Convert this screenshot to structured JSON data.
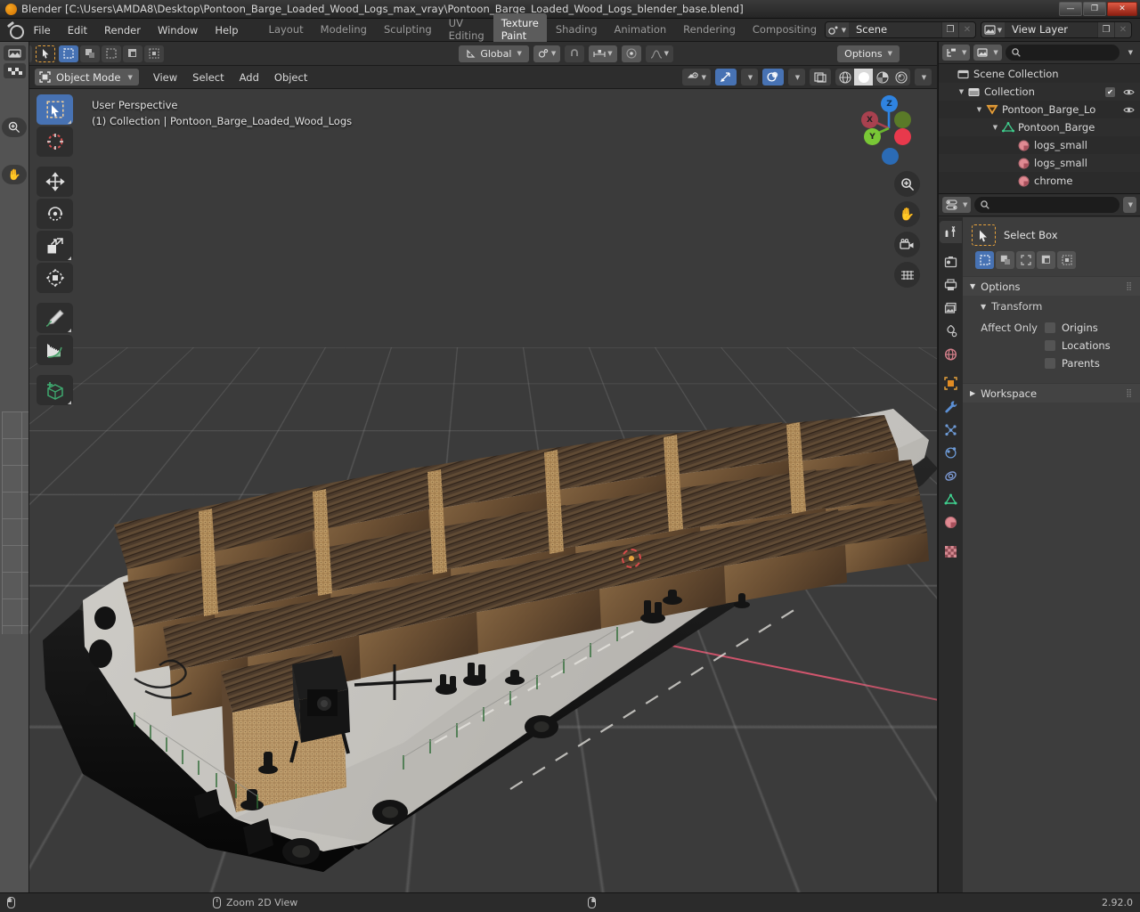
{
  "window": {
    "title": "Blender [C:\\Users\\AMDA8\\Desktop\\Pontoon_Barge_Loaded_Wood_Logs_max_vray\\Pontoon_Barge_Loaded_Wood_Logs_blender_base.blend]",
    "minimize": "—",
    "maximize": "❐",
    "close": "✕"
  },
  "topbar": {
    "menus": [
      "File",
      "Edit",
      "Render",
      "Window",
      "Help"
    ],
    "workspaces": [
      {
        "label": "Layout",
        "active": false
      },
      {
        "label": "Modeling",
        "active": false
      },
      {
        "label": "Sculpting",
        "active": false
      },
      {
        "label": "UV Editing",
        "active": false
      },
      {
        "label": "Texture Paint",
        "active": true
      },
      {
        "label": "Shading",
        "active": false
      },
      {
        "label": "Animation",
        "active": false
      },
      {
        "label": "Rendering",
        "active": false
      },
      {
        "label": "Compositing",
        "active": false
      }
    ],
    "scene": {
      "name": "Scene",
      "new_label": "❐",
      "unlink_label": "✕"
    },
    "view_layer": {
      "name": "View Layer",
      "new_label": "❐",
      "unlink_label": "✕"
    }
  },
  "tool_settings": {
    "transform_orientation": "Global",
    "options_label": "Options",
    "snap_icon": "magnet-icon",
    "proportional_icon": "proportional-edit-icon"
  },
  "viewport_header": {
    "mode": "Object Mode",
    "menus": [
      "View",
      "Select",
      "Add",
      "Object"
    ],
    "shading_modes": [
      "wireframe",
      "solid",
      "material-preview",
      "rendered"
    ],
    "active_shading": "solid"
  },
  "viewport": {
    "perspective_label": "User Perspective",
    "scene_info": "(1) Collection | Pontoon_Barge_Loaded_Wood_Logs",
    "gizmo_axes": [
      "X",
      "Y",
      "Z"
    ],
    "nav_buttons": [
      "zoom-icon",
      "pan-icon",
      "camera-icon",
      "grid-icon"
    ],
    "toolbar": [
      {
        "name": "select-box",
        "label": "Select Box",
        "active": true
      },
      {
        "name": "cursor",
        "label": "Cursor",
        "active": false
      },
      {
        "name": "move",
        "label": "Move",
        "active": false
      },
      {
        "name": "rotate",
        "label": "Rotate",
        "active": false
      },
      {
        "name": "scale",
        "label": "Scale",
        "active": false
      },
      {
        "name": "transform",
        "label": "Transform",
        "active": false
      },
      {
        "name": "annotate",
        "label": "Annotate",
        "active": false
      },
      {
        "name": "measure",
        "label": "Measure",
        "active": false
      },
      {
        "name": "add-cube",
        "label": "Add Cube",
        "active": false
      }
    ]
  },
  "outliner": {
    "search_placeholder": "",
    "rows": [
      {
        "label": "Scene Collection",
        "depth": 0,
        "icon": "collection-icon",
        "expand": "",
        "checkbox": false,
        "eye": false
      },
      {
        "label": "Collection",
        "depth": 1,
        "icon": "collection-icon",
        "expand": "▼",
        "checkbox": true,
        "eye": true
      },
      {
        "label": "Pontoon_Barge_Loа",
        "depth": 2,
        "icon": "empty-icon",
        "expand": "▼",
        "checkbox": false,
        "eye": true
      },
      {
        "label": "Pontoon_Barge",
        "depth": 3,
        "icon": "mesh-icon",
        "expand": "▼",
        "checkbox": false,
        "eye": false
      },
      {
        "label": "logs_small",
        "depth": 4,
        "icon": "material-icon",
        "expand": "",
        "checkbox": false,
        "eye": false
      },
      {
        "label": "logs_small",
        "depth": 4,
        "icon": "material-icon",
        "expand": "",
        "checkbox": false,
        "eye": false
      },
      {
        "label": "chrome",
        "depth": 4,
        "icon": "material-icon",
        "expand": "",
        "checkbox": false,
        "eye": false
      }
    ]
  },
  "properties": {
    "search_placeholder": "",
    "tabs": [
      {
        "name": "tool",
        "icon": "tool-icon",
        "active": true
      },
      {
        "name": "render",
        "icon": "render-icon",
        "active": false
      },
      {
        "name": "output",
        "icon": "output-icon",
        "active": false
      },
      {
        "name": "view-layer",
        "icon": "view-layer-icon",
        "active": false
      },
      {
        "name": "scene",
        "icon": "scene-icon",
        "active": false
      },
      {
        "name": "world",
        "icon": "world-icon",
        "active": false
      },
      {
        "name": "object",
        "icon": "object-icon",
        "active": false
      },
      {
        "name": "modifiers",
        "icon": "wrench-icon",
        "active": false
      },
      {
        "name": "particles",
        "icon": "particles-icon",
        "active": false
      },
      {
        "name": "physics",
        "icon": "physics-icon",
        "active": false
      },
      {
        "name": "constraints",
        "icon": "constraints-icon",
        "active": false
      },
      {
        "name": "data",
        "icon": "mesh-data-icon",
        "active": false
      },
      {
        "name": "material",
        "icon": "material-icon",
        "active": false
      },
      {
        "name": "texture",
        "icon": "texture-icon",
        "active": false
      }
    ],
    "active_tool": "Select Box",
    "select_modes": [
      "set",
      "extend",
      "subtract",
      "invert",
      "intersect"
    ],
    "active_select_mode": "set",
    "panels": {
      "options": {
        "label": "Options",
        "expanded": true
      },
      "transform": {
        "label": "Transform",
        "expanded": true
      },
      "affect_only_label": "Affect Only",
      "affect_only": [
        {
          "label": "Origins",
          "checked": false
        },
        {
          "label": "Locations",
          "checked": false
        },
        {
          "label": "Parents",
          "checked": false
        }
      ],
      "workspace": {
        "label": "Workspace",
        "expanded": false
      }
    }
  },
  "statusbar": {
    "hint": "Zoom 2D View",
    "version": "2.92.0"
  },
  "colors": {
    "accent_blue": "#4772b3",
    "accent_orange": "#e8a33d",
    "axis_x": "#c04d63",
    "axis_y": "#6ab52f",
    "axis_z": "#2f83e0",
    "header_bg": "#2b2b2b",
    "panel_bg": "#3d3d3d",
    "viewport_bg": "#3b3b3b"
  }
}
